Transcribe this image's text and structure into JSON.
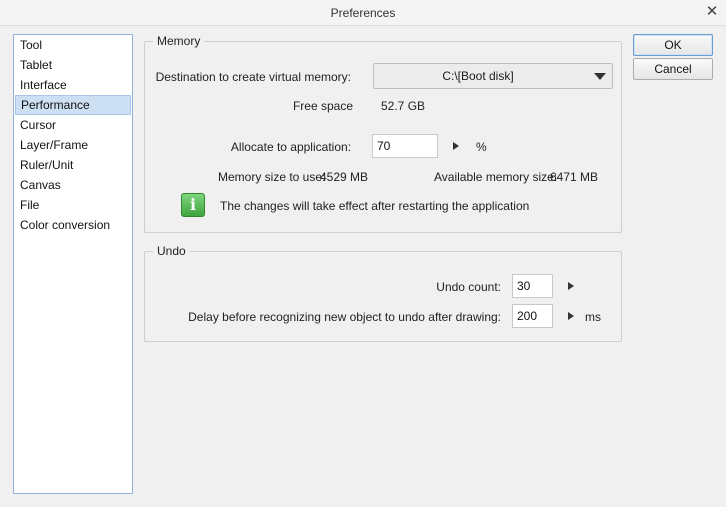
{
  "window": {
    "title": "Preferences",
    "close_glyph": "✕"
  },
  "nav": {
    "items": [
      {
        "label": "Tool"
      },
      {
        "label": "Tablet"
      },
      {
        "label": "Interface"
      },
      {
        "label": "Performance",
        "selected": true
      },
      {
        "label": "Cursor"
      },
      {
        "label": "Layer/Frame"
      },
      {
        "label": "Ruler/Unit"
      },
      {
        "label": "Canvas"
      },
      {
        "label": "File"
      },
      {
        "label": "Color conversion"
      }
    ]
  },
  "memory": {
    "legend": "Memory",
    "destination_label": "Destination to create virtual memory:",
    "destination_value": "C:\\[Boot disk]",
    "free_space_label": "Free space",
    "free_space_value": "52.7 GB",
    "allocate_label": "Allocate to application:",
    "allocate_value": "70",
    "allocate_unit": "%",
    "size_to_use_label": "Memory size to use:",
    "size_to_use_value": "4529 MB",
    "available_label": "Available memory size:",
    "available_value": "6471 MB",
    "notice": "The changes will take effect after restarting the application",
    "info_glyph": "i"
  },
  "undo": {
    "legend": "Undo",
    "count_label": "Undo count:",
    "count_value": "30",
    "delay_label": "Delay before recognizing new object to undo after drawing:",
    "delay_value": "200",
    "delay_unit": "ms"
  },
  "buttons": {
    "ok": "OK",
    "cancel": "Cancel"
  },
  "icons": {
    "close": "close-icon",
    "dropdown": "chevron-down-icon",
    "stepper": "triangle-right-icon",
    "info": "info-icon"
  },
  "colors": {
    "selection": "#cde0f3",
    "info_green": "#3fa43f",
    "nav_border": "#8fb4d8"
  }
}
